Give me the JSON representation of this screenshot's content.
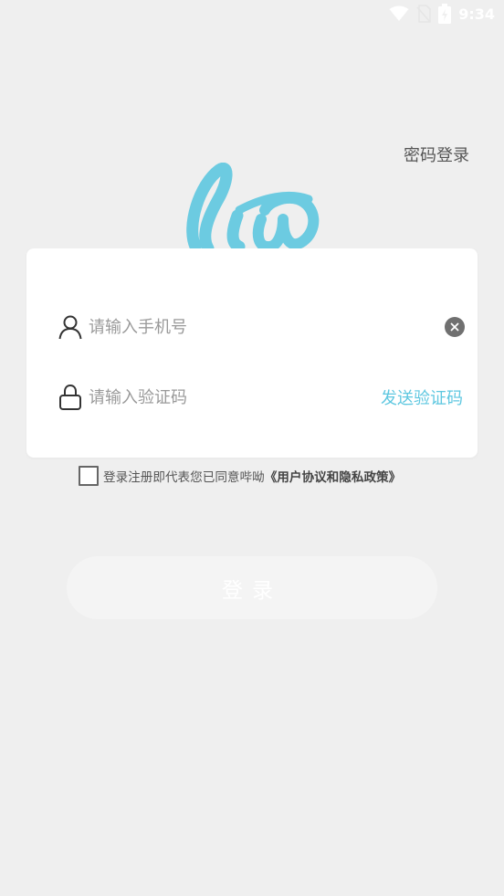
{
  "status_bar": {
    "time": "9:34",
    "icons": [
      "wifi-icon",
      "sim-off-icon",
      "battery-charging-icon"
    ]
  },
  "header": {
    "password_login_label": "密码登录"
  },
  "logo": {
    "icon": "liw-logo-icon",
    "color": "#6ccbe1"
  },
  "form": {
    "phone": {
      "icon": "user-icon",
      "placeholder": "请输入手机号",
      "value": "",
      "clear_icon": "clear-icon"
    },
    "code": {
      "icon": "lock-icon",
      "placeholder": "请输入验证码",
      "value": "",
      "send_label": "发送验证码"
    }
  },
  "agreement": {
    "text": "登录注册即代表您已同意哔呦",
    "link": "《用户协议和隐私政策》",
    "checked": false
  },
  "login_button": {
    "label": "登录"
  },
  "colors": {
    "background": "#efefef",
    "card": "#ffffff",
    "accent": "#5ec7e0",
    "button_disabled": "#f4f4f4"
  }
}
